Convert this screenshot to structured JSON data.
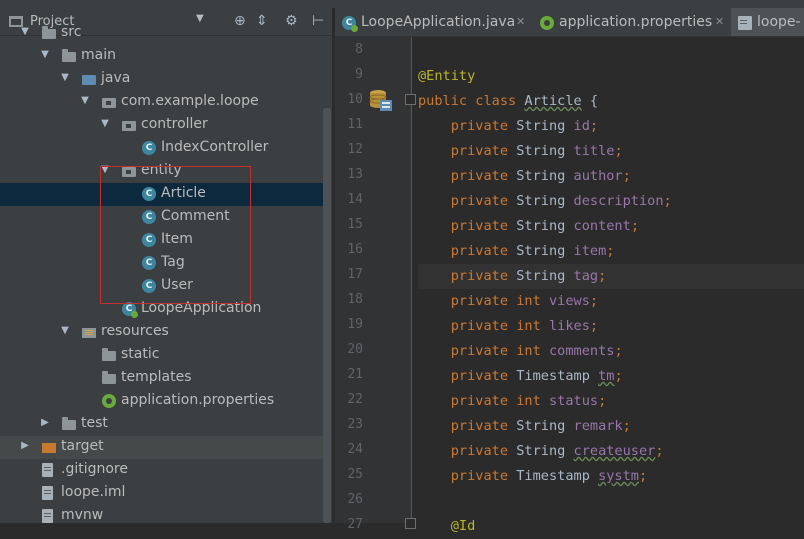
{
  "project_panel": {
    "title": "Project",
    "tree": [
      {
        "label": "src",
        "icon": "folder-icon",
        "arrow": "down",
        "level": 1
      },
      {
        "label": "main",
        "icon": "folder-icon",
        "arrow": "down",
        "level": 2
      },
      {
        "label": "java",
        "icon": "java-folder-icon",
        "arrow": "down",
        "level": 3
      },
      {
        "label": "com.example.loope",
        "icon": "pkg-icon",
        "arrow": "down",
        "level": 4
      },
      {
        "label": "controller",
        "icon": "pkg-icon",
        "arrow": "down",
        "level": 5
      },
      {
        "label": "IndexController",
        "icon": "class-icon",
        "arrow": "",
        "level": 6
      },
      {
        "label": "entity",
        "icon": "pkg-icon",
        "arrow": "down",
        "level": 5
      },
      {
        "label": "Article",
        "icon": "class-icon",
        "arrow": "",
        "level": 6,
        "selected": true
      },
      {
        "label": "Comment",
        "icon": "class-icon",
        "arrow": "",
        "level": 6
      },
      {
        "label": "Item",
        "icon": "class-icon",
        "arrow": "",
        "level": 6
      },
      {
        "label": "Tag",
        "icon": "class-icon",
        "arrow": "",
        "level": 6
      },
      {
        "label": "User",
        "icon": "class-icon",
        "arrow": "",
        "level": 6
      },
      {
        "label": "LoopeApplication",
        "icon": "springboot-icon",
        "arrow": "",
        "level": 5
      },
      {
        "label": "resources",
        "icon": "res-icon",
        "arrow": "down",
        "level": 3
      },
      {
        "label": "static",
        "icon": "folder-icon",
        "arrow": "",
        "level": 4
      },
      {
        "label": "templates",
        "icon": "folder-icon",
        "arrow": "",
        "level": 4
      },
      {
        "label": "application.properties",
        "icon": "props-icon",
        "arrow": "",
        "level": 4
      },
      {
        "label": "test",
        "icon": "folder-icon",
        "arrow": "right",
        "level": 2
      },
      {
        "label": "target",
        "icon": "orange-folder-icon",
        "arrow": "right",
        "level": 1,
        "dim": true
      },
      {
        "label": ".gitignore",
        "icon": "file-icon",
        "arrow": "",
        "level": 1
      },
      {
        "label": "loope.iml",
        "icon": "file-icon",
        "arrow": "",
        "level": 1
      },
      {
        "label": "mvnw",
        "icon": "file-icon",
        "arrow": "",
        "level": 1
      }
    ]
  },
  "tabs": [
    {
      "label": "LoopeApplication.java",
      "icon": "springboot-icon",
      "active": false
    },
    {
      "label": "application.properties",
      "icon": "props-icon",
      "active": false
    },
    {
      "label": "loope-",
      "icon": "file-icon",
      "active": true
    }
  ],
  "editor": {
    "lines": [
      {
        "num": "8",
        "segments": []
      },
      {
        "num": "9",
        "segments": [
          {
            "t": "@Entity",
            "c": "ann"
          }
        ]
      },
      {
        "num": "10",
        "segments": [
          {
            "t": "public class ",
            "c": "kw"
          },
          {
            "t": "Article",
            "c": "typo"
          },
          {
            "t": " {",
            "c": ""
          }
        ]
      },
      {
        "num": "11",
        "segments": [
          {
            "t": "    private ",
            "c": "kw"
          },
          {
            "t": "String ",
            "c": ""
          },
          {
            "t": "id",
            "c": "fld"
          },
          {
            "t": ";",
            "c": "kw"
          }
        ]
      },
      {
        "num": "12",
        "segments": [
          {
            "t": "    private ",
            "c": "kw"
          },
          {
            "t": "String ",
            "c": ""
          },
          {
            "t": "title",
            "c": "fld"
          },
          {
            "t": ";",
            "c": "kw"
          }
        ]
      },
      {
        "num": "13",
        "segments": [
          {
            "t": "    private ",
            "c": "kw"
          },
          {
            "t": "String ",
            "c": ""
          },
          {
            "t": "author",
            "c": "fld"
          },
          {
            "t": ";",
            "c": "kw"
          }
        ]
      },
      {
        "num": "14",
        "segments": [
          {
            "t": "    private ",
            "c": "kw"
          },
          {
            "t": "String ",
            "c": ""
          },
          {
            "t": "description",
            "c": "fld"
          },
          {
            "t": ";",
            "c": "kw"
          }
        ]
      },
      {
        "num": "15",
        "segments": [
          {
            "t": "    private ",
            "c": "kw"
          },
          {
            "t": "String ",
            "c": ""
          },
          {
            "t": "content",
            "c": "fld"
          },
          {
            "t": ";",
            "c": "kw"
          }
        ]
      },
      {
        "num": "16",
        "segments": [
          {
            "t": "    private ",
            "c": "kw"
          },
          {
            "t": "String ",
            "c": ""
          },
          {
            "t": "item",
            "c": "fld"
          },
          {
            "t": ";",
            "c": "kw"
          }
        ]
      },
      {
        "num": "17",
        "current": true,
        "segments": [
          {
            "t": "    private ",
            "c": "kw"
          },
          {
            "t": "String ",
            "c": ""
          },
          {
            "t": "tag",
            "c": "fld"
          },
          {
            "t": ";",
            "c": "kw"
          }
        ]
      },
      {
        "num": "18",
        "segments": [
          {
            "t": "    private ",
            "c": "kw"
          },
          {
            "t": "int ",
            "c": "kw"
          },
          {
            "t": "views",
            "c": "fld"
          },
          {
            "t": ";",
            "c": "kw"
          }
        ]
      },
      {
        "num": "19",
        "segments": [
          {
            "t": "    private ",
            "c": "kw"
          },
          {
            "t": "int ",
            "c": "kw"
          },
          {
            "t": "likes",
            "c": "fld"
          },
          {
            "t": ";",
            "c": "kw"
          }
        ]
      },
      {
        "num": "20",
        "segments": [
          {
            "t": "    private ",
            "c": "kw"
          },
          {
            "t": "int ",
            "c": "kw"
          },
          {
            "t": "comments",
            "c": "fld"
          },
          {
            "t": ";",
            "c": "kw"
          }
        ]
      },
      {
        "num": "21",
        "segments": [
          {
            "t": "    private ",
            "c": "kw"
          },
          {
            "t": "Timestamp ",
            "c": ""
          },
          {
            "t": "tm",
            "c": "fld typo"
          },
          {
            "t": ";",
            "c": "kw"
          }
        ]
      },
      {
        "num": "22",
        "segments": [
          {
            "t": "    private ",
            "c": "kw"
          },
          {
            "t": "int ",
            "c": "kw"
          },
          {
            "t": "status",
            "c": "fld"
          },
          {
            "t": ";",
            "c": "kw"
          }
        ]
      },
      {
        "num": "23",
        "segments": [
          {
            "t": "    private ",
            "c": "kw"
          },
          {
            "t": "String ",
            "c": ""
          },
          {
            "t": "remark",
            "c": "fld"
          },
          {
            "t": ";",
            "c": "kw"
          }
        ]
      },
      {
        "num": "24",
        "segments": [
          {
            "t": "    private ",
            "c": "kw"
          },
          {
            "t": "String ",
            "c": ""
          },
          {
            "t": "createuser",
            "c": "fld typo"
          },
          {
            "t": ";",
            "c": "kw"
          }
        ]
      },
      {
        "num": "25",
        "segments": [
          {
            "t": "    private ",
            "c": "kw"
          },
          {
            "t": "Timestamp ",
            "c": ""
          },
          {
            "t": "systm",
            "c": "fld typo"
          },
          {
            "t": ";",
            "c": "kw"
          }
        ]
      },
      {
        "num": "26",
        "segments": []
      },
      {
        "num": "27",
        "segments": [
          {
            "t": "    @Id",
            "c": "ann"
          }
        ]
      }
    ]
  },
  "colors": {
    "panel_bg": "#3c3f41",
    "editor_bg": "#2b2b2b",
    "selection": "#0d293e",
    "keyword": "#cc7832",
    "annotation": "#bbb529",
    "field": "#9876aa",
    "highlight_box": "#c42f2f"
  }
}
